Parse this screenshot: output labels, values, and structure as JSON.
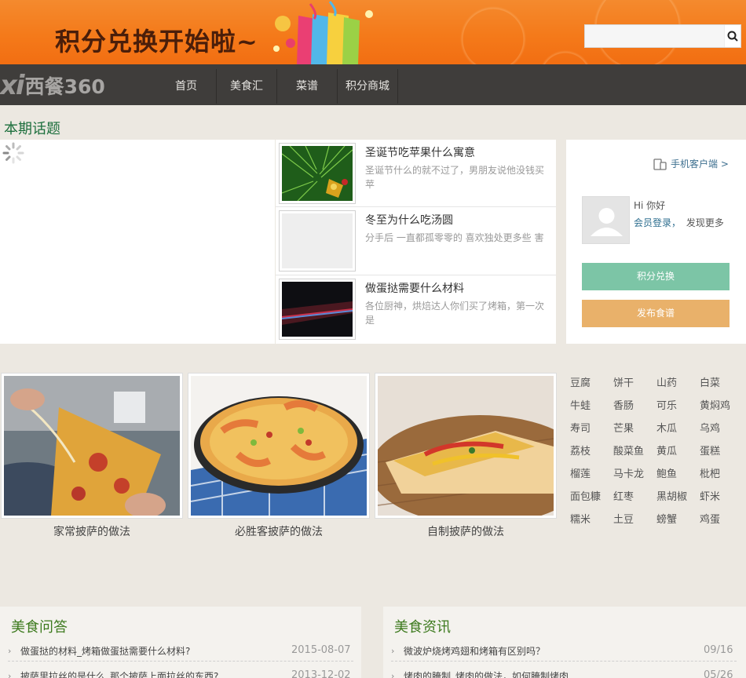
{
  "banner": {
    "title": "积分兑换开始啦~"
  },
  "search": {
    "placeholder": "",
    "value": ""
  },
  "logo": {
    "prefix": "xi",
    "name": "西餐360"
  },
  "nav": {
    "items": [
      "首页",
      "美食汇",
      "菜谱",
      "积分商城"
    ]
  },
  "topics": {
    "heading": "本期话题",
    "items": [
      {
        "title": "圣诞节吃苹果什么寓意",
        "desc": "圣诞节什么的就不过了，男朋友说他没钱买苹"
      },
      {
        "title": "冬至为什么吃汤圆",
        "desc": "分手后 一直都孤零零的 喜欢独处更多些 害"
      },
      {
        "title": "做蛋挞需要什么材料",
        "desc": "各位厨神，烘焙达人你们买了烤箱，第一次是"
      }
    ]
  },
  "member": {
    "client_link": "手机客户端 >",
    "greeting": "Hi 你好",
    "login_link": "会员登录，",
    "discover": "发现更多",
    "exchange_button": "积分兑换",
    "publish_button": "发布食谱"
  },
  "recipes": [
    {
      "caption": "家常披萨的做法"
    },
    {
      "caption": "必胜客披萨的做法"
    },
    {
      "caption": "自制披萨的做法"
    }
  ],
  "tags": [
    "豆腐",
    "饼干",
    "山药",
    "白菜",
    "牛蛙",
    "香肠",
    "可乐",
    "黄焖鸡",
    "寿司",
    "芒果",
    "木瓜",
    "乌鸡",
    "荔枝",
    "酸菜鱼",
    "黄瓜",
    "蛋糕",
    "榴莲",
    "马卡龙",
    "鲍鱼",
    "枇杷",
    "面包糠",
    "红枣",
    "黑胡椒",
    "虾米",
    "糯米",
    "土豆",
    "螃蟹",
    "鸡蛋"
  ],
  "qa": {
    "heading": "美食问答",
    "items": [
      {
        "title": "做蛋挞的材料_烤箱做蛋挞需要什么材料?",
        "date": "2015-08-07"
      },
      {
        "title": "披萨里拉丝的是什么_那个披萨上面拉丝的东西?",
        "date": "2013-12-02"
      }
    ]
  },
  "news": {
    "heading": "美食资讯",
    "items": [
      {
        "title": "微波炉烧烤鸡翅和烤箱有区别吗？",
        "date": "09/16"
      },
      {
        "title": "烤肉的腌制_烤肉的做法，如何腌制烤肉",
        "date": "05/26"
      }
    ]
  }
}
